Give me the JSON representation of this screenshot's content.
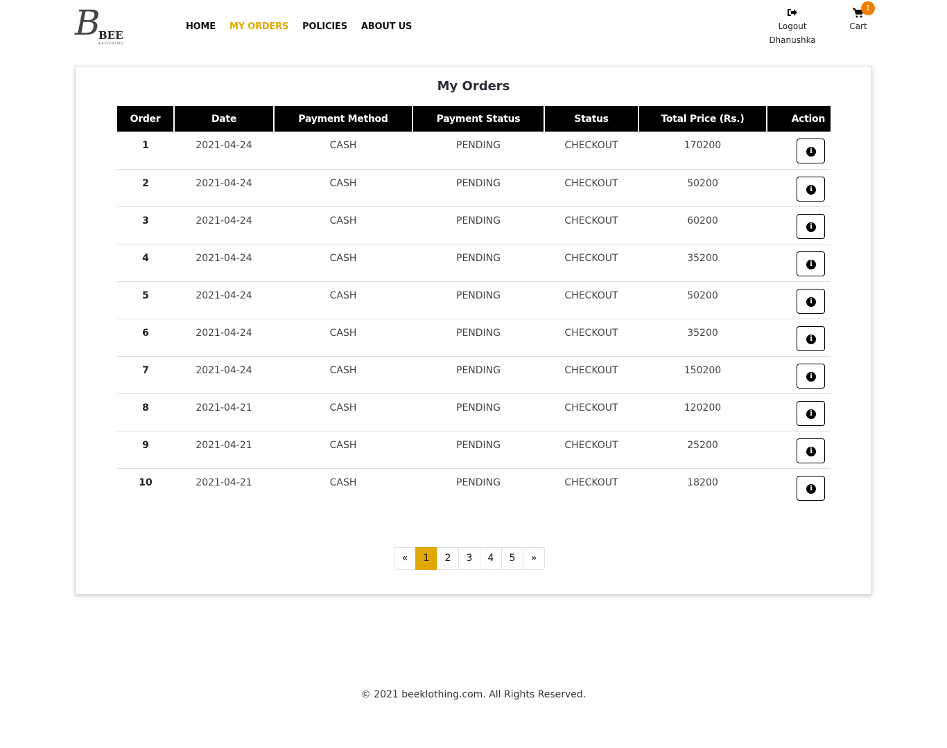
{
  "brand": {
    "logo_letter": "B",
    "logo_name": "BEE",
    "logo_sub": "KLOTHING"
  },
  "nav": {
    "items": [
      {
        "label": "HOME"
      },
      {
        "label": "MY ORDERS"
      },
      {
        "label": "POLICIES"
      },
      {
        "label": "ABOUT US"
      }
    ],
    "active_color": "#e0a800"
  },
  "user": {
    "icon": "sign-out-icon",
    "action_label": "Logout",
    "name": "Dhanushka"
  },
  "cart": {
    "icon": "shopping-cart-icon",
    "label": "Cart",
    "count": "1",
    "badge_color": "#f07c00"
  },
  "orders": {
    "title": "My Orders",
    "columns": [
      "Order",
      "Date",
      "Payment Method",
      "Payment Status",
      "Status",
      "Total Price (Rs.)",
      "Action"
    ],
    "rows": [
      {
        "order": "1",
        "date": "2021-04-24",
        "payment_method": "CASH",
        "payment_status": "PENDING",
        "status": "CHECKOUT",
        "total": "170200"
      },
      {
        "order": "2",
        "date": "2021-04-24",
        "payment_method": "CASH",
        "payment_status": "PENDING",
        "status": "CHECKOUT",
        "total": "50200"
      },
      {
        "order": "3",
        "date": "2021-04-24",
        "payment_method": "CASH",
        "payment_status": "PENDING",
        "status": "CHECKOUT",
        "total": "60200"
      },
      {
        "order": "4",
        "date": "2021-04-24",
        "payment_method": "CASH",
        "payment_status": "PENDING",
        "status": "CHECKOUT",
        "total": "35200"
      },
      {
        "order": "5",
        "date": "2021-04-24",
        "payment_method": "CASH",
        "payment_status": "PENDING",
        "status": "CHECKOUT",
        "total": "50200"
      },
      {
        "order": "6",
        "date": "2021-04-24",
        "payment_method": "CASH",
        "payment_status": "PENDING",
        "status": "CHECKOUT",
        "total": "35200"
      },
      {
        "order": "7",
        "date": "2021-04-24",
        "payment_method": "CASH",
        "payment_status": "PENDING",
        "status": "CHECKOUT",
        "total": "150200"
      },
      {
        "order": "8",
        "date": "2021-04-21",
        "payment_method": "CASH",
        "payment_status": "PENDING",
        "status": "CHECKOUT",
        "total": "120200"
      },
      {
        "order": "9",
        "date": "2021-04-21",
        "payment_method": "CASH",
        "payment_status": "PENDING",
        "status": "CHECKOUT",
        "total": "25200"
      },
      {
        "order": "10",
        "date": "2021-04-21",
        "payment_method": "CASH",
        "payment_status": "PENDING",
        "status": "CHECKOUT",
        "total": "18200"
      }
    ],
    "action_icon": "info-circle-icon"
  },
  "pagination": {
    "prev": "«",
    "pages": [
      "1",
      "2",
      "3",
      "4",
      "5"
    ],
    "current": "1",
    "next": "»"
  },
  "footer": {
    "text": "© 2021 beeklothing.com. All Rights Reserved."
  }
}
